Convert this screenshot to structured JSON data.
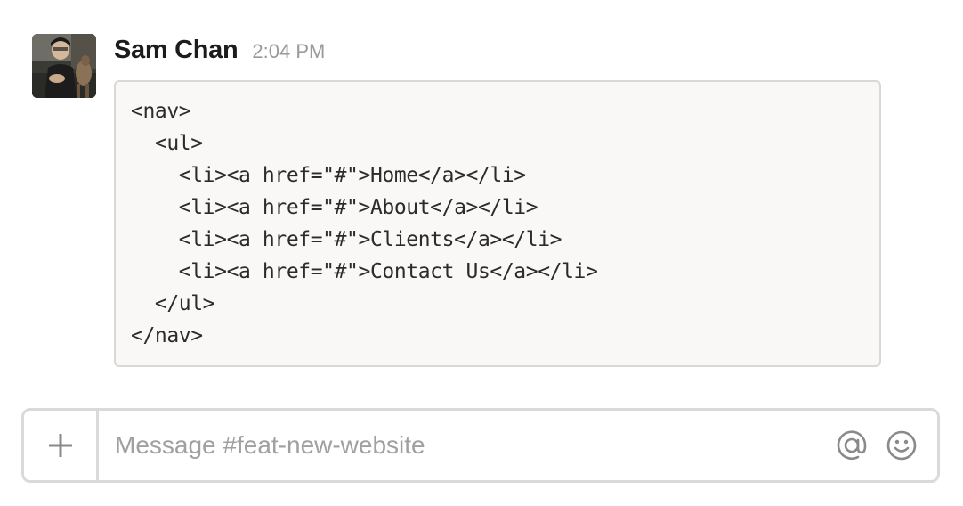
{
  "message": {
    "author": "Sam Chan",
    "timestamp": "2:04 PM",
    "avatar_icon": "user-photo-avatar",
    "code_lines": [
      "<nav>",
      "  <ul>",
      "    <li><a href=\"#\">Home</a></li>",
      "    <li><a href=\"#\">About</a></li>",
      "    <li><a href=\"#\">Clients</a></li>",
      "    <li><a href=\"#\">Contact Us</a></li>",
      "  </ul>",
      "</nav>"
    ]
  },
  "composer": {
    "placeholder": "Message #feat-new-website",
    "value": "",
    "add_icon": "plus-icon",
    "mention_icon": "at-sign-icon",
    "emoji_icon": "smiley-icon"
  },
  "colors": {
    "code_background": "#f9f8f7",
    "border": "#dadada",
    "timestamp": "#9a9a9a",
    "icon": "#8a8a8a"
  }
}
